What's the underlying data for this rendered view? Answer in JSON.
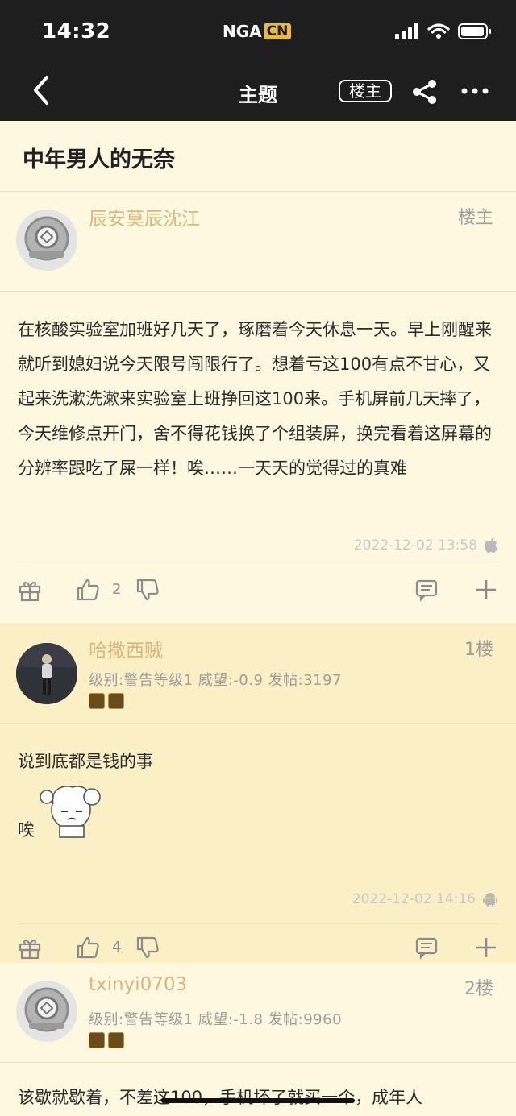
{
  "status_bar": {
    "time": "14:32",
    "logo_left": "NGA",
    "logo_right": "CN"
  },
  "nav": {
    "title": "主题",
    "op_label": "楼主"
  },
  "thread": {
    "title": "中年男人的无奈"
  },
  "posts": [
    {
      "username": "辰安莫辰沈江",
      "floor": "楼主",
      "body": "在核酸实验室加班好几天了，琢磨着今天休息一天。早上刚醒来就听到媳妇说今天限号闯限行了。想着亏这100有点不甘心，又起来洗漱洗漱来实验室上班挣回这100来。手机屏前几天摔了，今天维修点开门，舍不得花钱换了个组装屏，换完看着这屏幕的分辨率跟吃了屎一样！唉……一天天的觉得过的真难",
      "time": "2022-12-02 13:58",
      "device_icon": "apple-icon",
      "likes": "2"
    },
    {
      "username": "哈撒西贼",
      "floor": "1楼",
      "meta": "级别:警告等级1   威望:-0.9   发帖:3197",
      "body_line1": "说到底都是钱的事",
      "body_line2": "唉",
      "time": "2022-12-02 14:16",
      "device_icon": "android-icon",
      "likes": "4"
    },
    {
      "username": "txinyi0703",
      "floor": "2楼",
      "meta": "级别:警告等级1   威望:-1.8   发帖:9960",
      "body": "该歇就歇着，不差这100，手机坏了就买一个，成年人"
    }
  ],
  "colors": {
    "background": "#fff8e0",
    "alt_background": "#fbefc6",
    "username": "#d9b67a",
    "topbar": "#1e1e1e"
  }
}
